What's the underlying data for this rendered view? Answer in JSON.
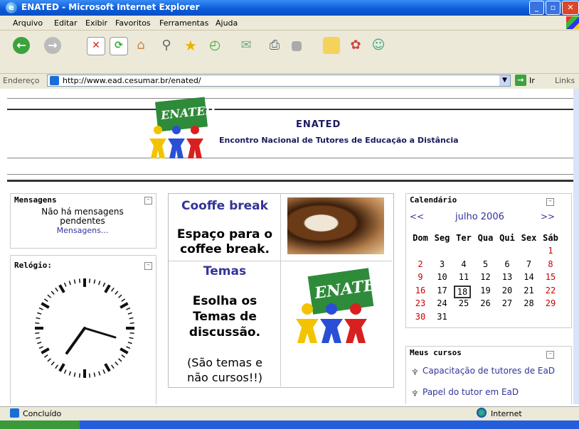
{
  "window": {
    "title": "ENATED - Microsoft Internet Explorer"
  },
  "menu": [
    "Arquivo",
    "Editar",
    "Exibir",
    "Favoritos",
    "Ferramentas",
    "Ajuda"
  ],
  "address": {
    "label": "Endereço",
    "url": "http://www.ead.cesumar.br/enated/",
    "go_label": "Ir",
    "links_label": "Links"
  },
  "header": {
    "logo_text": "ENATED",
    "title": "ENATED",
    "subtitle": "Encontro Nacional de Tutores de Educação a Distância"
  },
  "messages": {
    "title": "Mensagens",
    "line1": "Não há mensagens",
    "line2": "pendentes",
    "link": "Mensagens..."
  },
  "clock": {
    "title": "Relógio:",
    "time": "3:38"
  },
  "center": {
    "coffee_title": "Cooffe break",
    "coffee_text": "Espaço para o coffee break.",
    "themes_title": "Temas",
    "themes_text": "Esolha os Temas de discussão.",
    "themes_note": "(São temas e não cursos!!)",
    "logo_text": "ENATED"
  },
  "calendar": {
    "title": "Calendário",
    "prev": "<<",
    "next": ">>",
    "month": "julho 2006",
    "weekdays": [
      "Dom",
      "Seg",
      "Ter",
      "Qua",
      "Qui",
      "Sex",
      "Sáb"
    ],
    "weeks": [
      [
        "",
        "",
        "",
        "",
        "",
        "",
        "1"
      ],
      [
        "2",
        "3",
        "4",
        "5",
        "6",
        "7",
        "8"
      ],
      [
        "9",
        "10",
        "11",
        "12",
        "13",
        "14",
        "15"
      ],
      [
        "16",
        "17",
        "18",
        "19",
        "20",
        "21",
        "22"
      ],
      [
        "23",
        "24",
        "25",
        "26",
        "27",
        "28",
        "29"
      ],
      [
        "30",
        "31",
        "",
        "",
        "",
        "",
        ""
      ]
    ],
    "today": "18",
    "weekend_color": "#cc0000"
  },
  "courses": {
    "title": "Meus cursos",
    "items": [
      "Capacitação de tutores de EaD",
      "Papel do tutor em EaD"
    ]
  },
  "status": {
    "text": "Concluído",
    "zone": "Internet"
  },
  "colors": {
    "titlebar": "#0a5ad6",
    "link": "#33339a",
    "accent": "#1a1a5e"
  }
}
